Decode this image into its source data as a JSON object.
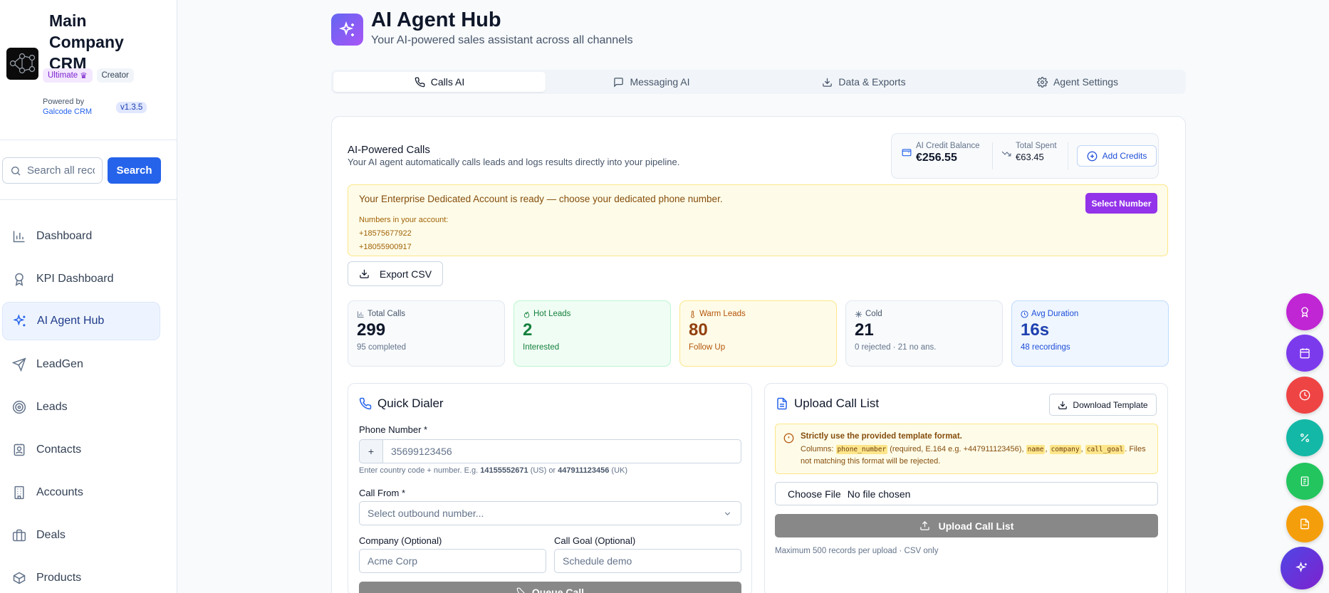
{
  "brand": {
    "title": "Main Company CRM",
    "badge_ultimate": "Ultimate",
    "badge_creator": "Creator",
    "powered_by": "Powered by",
    "powered_link": "Galcode CRM",
    "version": "v1.3.5"
  },
  "search": {
    "placeholder": "Search all records...",
    "button": "Search"
  },
  "nav": [
    {
      "label": "Dashboard",
      "icon": "bar-chart-icon"
    },
    {
      "label": "KPI Dashboard",
      "icon": "award-icon"
    },
    {
      "label": "AI Agent Hub",
      "icon": "sparkles-icon",
      "active": true
    },
    {
      "label": "LeadGen",
      "icon": "send-icon"
    },
    {
      "label": "Leads",
      "icon": "target-icon"
    },
    {
      "label": "Contacts",
      "icon": "contact-icon"
    },
    {
      "label": "Accounts",
      "icon": "building-icon"
    },
    {
      "label": "Deals",
      "icon": "briefcase-icon"
    },
    {
      "label": "Products",
      "icon": "package-icon"
    }
  ],
  "header": {
    "title": "AI Agent Hub",
    "subtitle": "Your AI-powered sales assistant across all channels"
  },
  "tabs": [
    {
      "label": "Calls AI",
      "icon": "phone-icon",
      "active": true
    },
    {
      "label": "Messaging AI",
      "icon": "message-icon"
    },
    {
      "label": "Data & Exports",
      "icon": "download-icon"
    },
    {
      "label": "Agent Settings",
      "icon": "gear-icon"
    }
  ],
  "calls": {
    "title": "AI-Powered Calls",
    "subtitle": "Your AI agent automatically calls leads and logs results directly into your pipeline.",
    "credit_label": "AI Credit Balance",
    "credit_value": "€256.55",
    "spent_label": "Total Spent",
    "spent_value": "€63.45",
    "add_credits": "Add Credits"
  },
  "alert": {
    "title": "Your Enterprise Dedicated Account is ready — choose your dedicated phone number.",
    "numbers_label": "Numbers in your account:",
    "numbers": [
      "+18575677922",
      "+18055900917"
    ],
    "button": "Select Number"
  },
  "export_label": "Export CSV",
  "stats": [
    {
      "label": "Total Calls",
      "value": "299",
      "sub": "95 completed",
      "icon": "bar-chart-icon"
    },
    {
      "label": "Hot Leads",
      "value": "2",
      "sub": "Interested",
      "icon": "flame-icon"
    },
    {
      "label": "Warm Leads",
      "value": "80",
      "sub": "Follow Up",
      "icon": "thermometer-icon"
    },
    {
      "label": "Cold",
      "value": "21",
      "sub": "0 rejected · 21 no ans.",
      "icon": "snowflake-icon"
    },
    {
      "label": "Avg Duration",
      "value": "16s",
      "sub": "48 recordings",
      "icon": "clock-icon"
    }
  ],
  "dialer": {
    "title": "Quick Dialer",
    "phone_label": "Phone Number *",
    "phone_prefix": "+",
    "phone_placeholder": "35699123456",
    "hint_pre": "Enter country code + number. E.g. ",
    "hint_us": "14155552671",
    "hint_mid": " (US) or ",
    "hint_uk": "447911123456",
    "hint_post": " (UK)",
    "from_label": "Call From *",
    "from_placeholder": "Select outbound number...",
    "company_label": "Company (Optional)",
    "company_placeholder": "Acme Corp",
    "goal_label": "Call Goal (Optional)",
    "goal_placeholder": "Schedule demo",
    "queue_button": "Queue Call"
  },
  "upload": {
    "title": "Upload Call List",
    "download_template": "Download Template",
    "warn_title": "Strictly use the provided template format.",
    "warn_columns": "Columns:",
    "col_phone": "phone_number",
    "col_phone_note": "(required, E.164 e.g. +447911123456),",
    "col_name": "name",
    "col_company": "company",
    "col_goal": "call_goal",
    "warn_tail": ". Files not matching this format will be rejected.",
    "choose_file": "Choose File",
    "no_file": "No file chosen",
    "upload_button": "Upload Call List",
    "upload_hint": "Maximum 500 records per upload · CSV only"
  },
  "fabs": [
    {
      "icon": "award-icon",
      "color": "#c026d3"
    },
    {
      "icon": "calendar-icon",
      "color": "#7c3aed"
    },
    {
      "icon": "clock-icon",
      "color": "#ef4444"
    },
    {
      "icon": "percent-icon",
      "color": "#14b8a6"
    },
    {
      "icon": "document-icon",
      "color": "#22c55e"
    },
    {
      "icon": "file-icon",
      "color": "#f59e0b"
    },
    {
      "icon": "sparkles-icon",
      "color": "#6d28d9"
    }
  ]
}
